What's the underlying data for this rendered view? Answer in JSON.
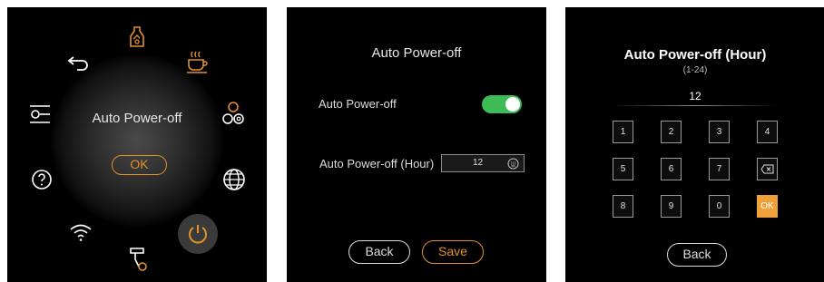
{
  "screen_menu": {
    "center_label": "Auto Power-off",
    "ok_label": "OK",
    "icons": [
      "back-arrow-icon",
      "cleaning-icon",
      "coffee-cup-icon",
      "settings-sliders-icon",
      "network-nodes-icon",
      "help-icon",
      "globe-icon",
      "wifi-icon",
      "power-icon",
      "milk-frother-icon"
    ]
  },
  "screen_settings": {
    "title": "Auto Power-off",
    "toggle_label": "Auto Power-off",
    "toggle_on": true,
    "hour_label": "Auto Power-off (Hour)",
    "hour_value": "12",
    "back_label": "Back",
    "save_label": "Save"
  },
  "screen_keypad": {
    "title": "Auto Power-off (Hour)",
    "range": "(1-24)",
    "value": "12",
    "keys_row1": [
      "1",
      "2",
      "3",
      "4"
    ],
    "keys_row2": [
      "5",
      "6",
      "7"
    ],
    "keys_row3": [
      "8",
      "9",
      "0"
    ],
    "ok_label": "OK",
    "back_label": "Back"
  },
  "colors": {
    "accent": "#e1902b",
    "toggle_on": "#3dbb55",
    "background": "#000000"
  }
}
